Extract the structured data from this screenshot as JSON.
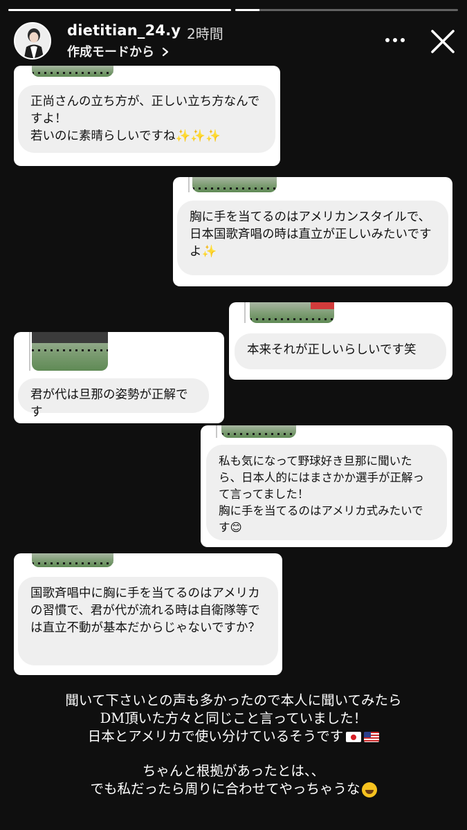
{
  "story": {
    "progress": [
      1.0,
      0.11
    ],
    "username": "dietitian_24.y",
    "time": "2時間",
    "subline": "作成モードから",
    "subline_chevron": "chevron-right-icon",
    "menu_icon": "more-horizontal-icon",
    "close_icon": "close-icon"
  },
  "messages": [
    {
      "side": "left",
      "text": "正尚さんの立ち方が、正しい立ち方なんですよ！\n若いのに素晴らしいですね",
      "emoji": "✨✨✨"
    },
    {
      "side": "right",
      "text": "胸に手を当てるのはアメリカンスタイルで、日本国歌斉唱の時は直立が正しいみたいですよ",
      "emoji": "✨"
    },
    {
      "side": "right",
      "text": "本来それが正しいらしいです笑",
      "emoji": ""
    },
    {
      "side": "left",
      "text": "君が代は旦那の姿勢が正解です",
      "emoji": ""
    },
    {
      "side": "right",
      "text": "私も気になって野球好き旦那に聞いたら、日本人的にはまさかか選手が正解って言ってました！\n胸に手を当てるのはアメリカ式みたいです",
      "emoji": "😊"
    },
    {
      "side": "left",
      "text": "国歌斉唱中に胸に手を当てるのはアメリカの習慣で、君が代が流れる時は自衛隊等では直立不動が基本だからじゃないですか？",
      "emoji": ""
    }
  ],
  "caption": {
    "line1": "聞いて下さいとの声も多かったので本人に聞いてみたら",
    "line2": "DM頂いた方々と同じこと言っていました！",
    "line3": "日本とアメリカで使い分けているそうです",
    "line3_flags": [
      "flag-japan-icon",
      "flag-usa-icon"
    ],
    "line4": "ちゃんと根拠があったとは、、",
    "line5": "でも私だったら周りに合わせてやっちゃうな",
    "line5_emoji": "rolling-laughing-icon"
  },
  "colors": {
    "background": "#0f0f0f",
    "card": "#ffffff",
    "bubble": "#efefef"
  }
}
